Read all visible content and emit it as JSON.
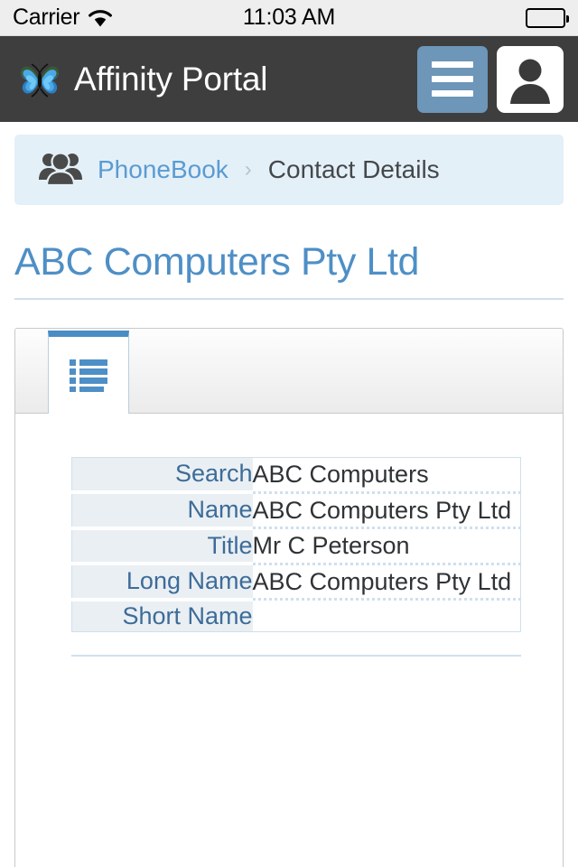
{
  "status_bar": {
    "carrier": "Carrier",
    "wifi_icon": "wifi-icon",
    "time": "11:03 AM",
    "battery_icon": "battery-full-icon"
  },
  "header": {
    "logo_icon": "butterfly-logo-icon",
    "title": "Affinity Portal",
    "menu_icon": "hamburger-menu-icon",
    "avatar_icon": "user-avatar-icon",
    "background_color": "#3e3e3e",
    "menu_button_color": "#6d96b8"
  },
  "breadcrumb": {
    "group_icon": "people-group-icon",
    "parent": "PhoneBook",
    "separator": "›",
    "current": "Contact Details",
    "background_color": "#e4f0f8",
    "link_color": "#5b9bd1"
  },
  "page": {
    "title": "ABC Computers Pty Ltd",
    "title_color": "#4e8fc6"
  },
  "tabs": [
    {
      "name": "details-list-tab",
      "icon": "list-view-icon",
      "active": true,
      "accent_color": "#4a8cc4"
    }
  ],
  "details": {
    "rows": [
      {
        "label": "Search",
        "value": "ABC Computers"
      },
      {
        "label": "Name",
        "value": "ABC Computers Pty Ltd"
      },
      {
        "label": "Title",
        "value": "Mr C Peterson"
      },
      {
        "label": "Long Name",
        "value": "ABC Computers Pty Ltd"
      },
      {
        "label": "Short Name",
        "value": ""
      }
    ],
    "label_color": "#3d6c99",
    "label_background": "#eaeff3",
    "value_color": "#2f3335",
    "border_color": "#cfe0ee"
  },
  "details_secondary": {
    "rows": [
      {
        "label": "",
        "value": ""
      }
    ]
  }
}
